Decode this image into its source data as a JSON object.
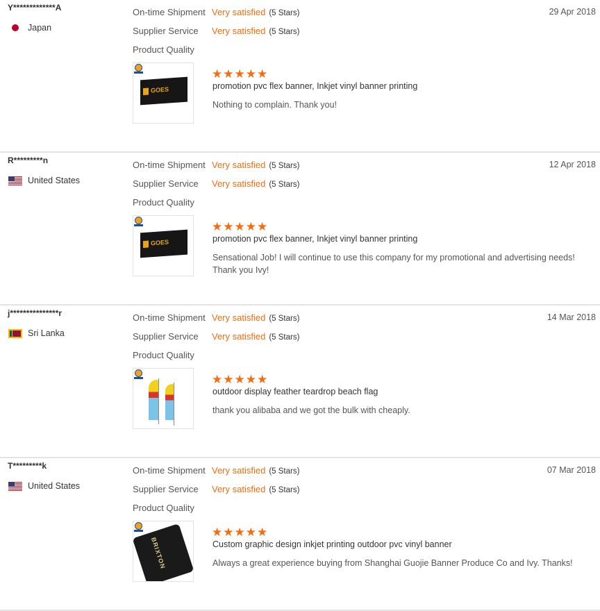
{
  "labels": {
    "ontime": "On-time Shipment",
    "service": "Supplier Service",
    "quality": "Product Quality",
    "rating_value": "Very satisfied",
    "rating_stars": "(5 Stars)",
    "star_glyphs": "★★★★★"
  },
  "colors": {
    "accent": "#f36d0f"
  },
  "reviews": [
    {
      "buyer": "Y*************A",
      "country": "Japan",
      "flag": "flag-japan-icon",
      "date": "29 Apr 2018",
      "product": "promotion pvc flex banner, Inkjet vinyl banner printing",
      "comment": "Nothing to complain. Thank you!"
    },
    {
      "buyer": "R*********n",
      "country": "United States",
      "flag": "flag-usa-icon",
      "date": "12 Apr 2018",
      "product": "promotion pvc flex banner, Inkjet vinyl banner printing",
      "comment": "Sensational Job! I will continue to use this company for my promotional and advertising needs! Thank you Ivy!"
    },
    {
      "buyer": "j***************r",
      "country": "Sri Lanka",
      "flag": "flag-sri-lanka-icon",
      "date": "14 Mar 2018",
      "product": "outdoor display feather teardrop beach flag",
      "comment": "thank you alibaba and we got the bulk with cheaply."
    },
    {
      "buyer": "T*********k",
      "country": "United States",
      "flag": "flag-usa-icon",
      "date": "07 Mar 2018",
      "product": "Custom graphic design inkjet printing outdoor pvc vinyl banner",
      "comment": "Always a great experience buying from Shanghai Guojie Banner Produce Co and Ivy. Thanks!"
    }
  ],
  "thumbnails": {
    "banner_text": "GOES",
    "tube_text": "BRIXTON"
  }
}
